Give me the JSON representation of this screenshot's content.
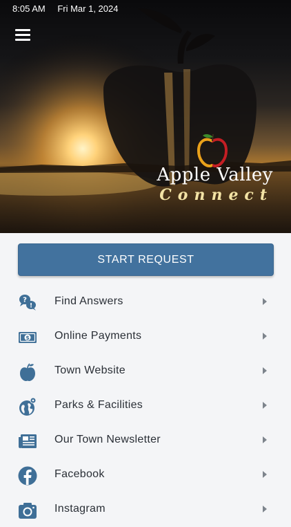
{
  "status_bar": {
    "time": "8:05 AM",
    "date": "Fri Mar 1, 2024"
  },
  "hero": {
    "brand_line1": "Apple Valley",
    "brand_line2": "Connect"
  },
  "start_button": {
    "label": "START REQUEST"
  },
  "menu_items": [
    {
      "label": "Find Answers",
      "icon": "question-bubbles-icon"
    },
    {
      "label": "Online Payments",
      "icon": "money-bill-icon"
    },
    {
      "label": "Town Website",
      "icon": "apple-icon"
    },
    {
      "label": "Parks & Facilities",
      "icon": "globe-pin-icon"
    },
    {
      "label": "Our Town Newsletter",
      "icon": "newspaper-icon"
    },
    {
      "label": "Facebook",
      "icon": "facebook-icon"
    },
    {
      "label": "Instagram",
      "icon": "camera-icon"
    }
  ],
  "colors": {
    "accent": "#42729e",
    "icon": "#3f6f97",
    "text": "#2a2f36",
    "background": "#f4f5f7"
  }
}
